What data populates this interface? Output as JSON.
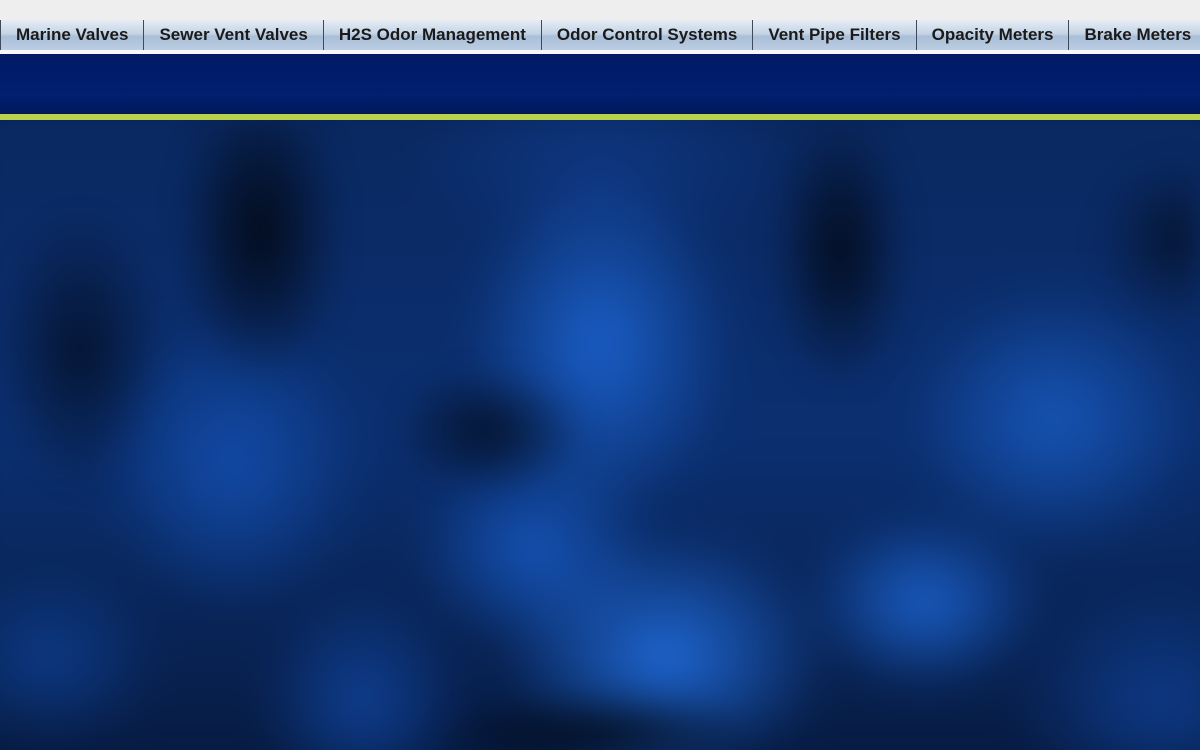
{
  "nav": {
    "items": [
      {
        "label": "Marine Valves"
      },
      {
        "label": "Sewer Vent Valves"
      },
      {
        "label": "H2S Odor Management"
      },
      {
        "label": "Odor Control Systems"
      },
      {
        "label": "Vent Pipe Filters"
      },
      {
        "label": "Opacity Meters"
      },
      {
        "label": "Brake Meters"
      }
    ]
  },
  "colors": {
    "nav_text": "#1a1a1a",
    "header_band": "#001f6e",
    "accent_line": "#b9d24a",
    "hero_blue": "#1a5fc8"
  }
}
